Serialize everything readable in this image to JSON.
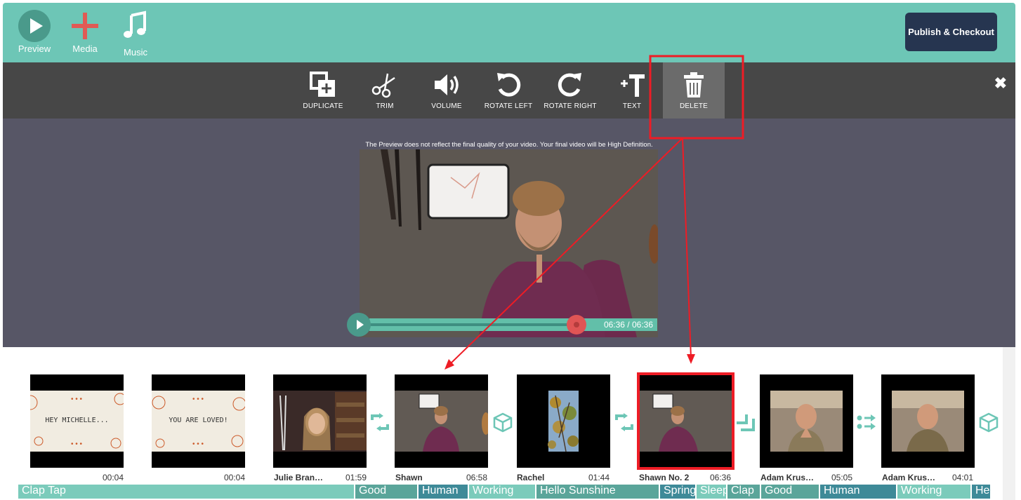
{
  "nav": {
    "preview": "Preview",
    "media": "Media",
    "music": "Music",
    "publish": "Publish & Checkout"
  },
  "toolbar": {
    "duplicate": "DUPLICATE",
    "trim": "TRIM",
    "volume": "VOLUME",
    "rotate_left": "ROTATE LEFT",
    "rotate_right": "ROTATE RIGHT",
    "text": "TEXT",
    "delete": "DELETE",
    "close": "✖"
  },
  "preview": {
    "notice": "The Preview does not reflect the final quality of your video. Your final video will be High Definition.",
    "time": "06:36 / 06:36",
    "progress": 0.72
  },
  "clips": [
    {
      "name": "",
      "duration": "00:04",
      "card": "HEY MICHELLE..."
    },
    {
      "name": "",
      "duration": "00:04",
      "card": "YOU ARE LOVED!"
    },
    {
      "name": "Julie Bran…",
      "duration": "01:59"
    },
    {
      "name": "Shawn",
      "duration": "06:58"
    },
    {
      "name": "Rachel",
      "duration": "01:44"
    },
    {
      "name": "Shawn No. 2",
      "duration": "06:36",
      "selected": true
    },
    {
      "name": "Adam Krus…",
      "duration": "05:05"
    },
    {
      "name": "Adam Krus…",
      "duration": "04:01"
    }
  ],
  "music_tracks": [
    "Clap Tap",
    "Good",
    "Human",
    "Working",
    "Hello Sunshine",
    "Spring",
    "Sleep",
    "Clap",
    "Good",
    "Human",
    "Working",
    "He"
  ],
  "colors": {
    "accent": "#6dc6b6",
    "toolbar": "#474747",
    "stage": "#575666",
    "publish": "#263550",
    "highlight": "#ee1c25"
  }
}
